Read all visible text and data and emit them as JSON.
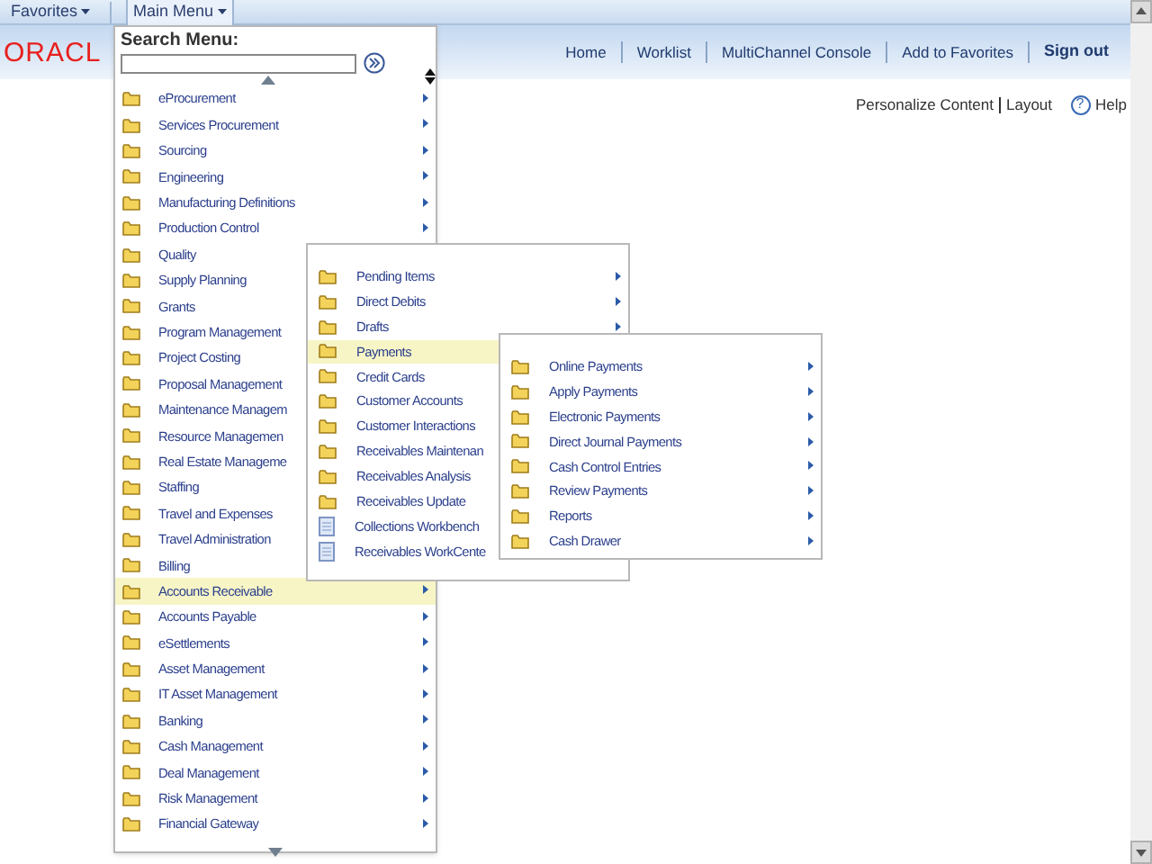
{
  "top_menu": [
    {
      "label": "Favorites",
      "selected": false
    },
    {
      "label": "Main Menu",
      "selected": true
    }
  ],
  "logo": "ORACL",
  "nav_links": [
    {
      "label": "Home",
      "bold": false
    },
    {
      "label": "Worklist",
      "bold": false
    },
    {
      "label": "MultiChannel Console",
      "bold": false
    },
    {
      "label": "Add to Favorites",
      "bold": false
    },
    {
      "label": "Sign out",
      "bold": true
    }
  ],
  "page_links": {
    "personalize": "Personalize Content",
    "layout": "Layout",
    "help": "Help",
    "help_icon": "?"
  },
  "main_menu": {
    "search_label": "Search Menu:",
    "items": [
      {
        "label": "eProcurement",
        "kind": "folder",
        "arrow": true,
        "selected": false
      },
      {
        "label": "Services Procurement",
        "kind": "folder",
        "arrow": true,
        "selected": false
      },
      {
        "label": "Sourcing",
        "kind": "folder",
        "arrow": true,
        "selected": false
      },
      {
        "label": "Engineering",
        "kind": "folder",
        "arrow": true,
        "selected": false
      },
      {
        "label": "Manufacturing Definitions",
        "kind": "folder",
        "arrow": true,
        "selected": false
      },
      {
        "label": "Production Control",
        "kind": "folder",
        "arrow": true,
        "selected": false
      },
      {
        "label": "Quality",
        "kind": "folder",
        "arrow": false,
        "selected": false
      },
      {
        "label": "Supply Planning",
        "kind": "folder",
        "arrow": false,
        "selected": false
      },
      {
        "label": "Grants",
        "kind": "folder",
        "arrow": false,
        "selected": false
      },
      {
        "label": "Program Management",
        "kind": "folder",
        "arrow": false,
        "selected": false
      },
      {
        "label": "Project Costing",
        "kind": "folder",
        "arrow": false,
        "selected": false
      },
      {
        "label": "Proposal Management",
        "kind": "folder",
        "arrow": false,
        "selected": false
      },
      {
        "label": "Maintenance Managem",
        "kind": "folder",
        "arrow": false,
        "selected": false
      },
      {
        "label": "Resource Managemen",
        "kind": "folder",
        "arrow": false,
        "selected": false
      },
      {
        "label": "Real Estate Manageme",
        "kind": "folder",
        "arrow": false,
        "selected": false
      },
      {
        "label": "Staffing",
        "kind": "folder",
        "arrow": false,
        "selected": false
      },
      {
        "label": "Travel and Expenses",
        "kind": "folder",
        "arrow": false,
        "selected": false
      },
      {
        "label": "Travel Administration",
        "kind": "folder",
        "arrow": false,
        "selected": false
      },
      {
        "label": "Billing",
        "kind": "folder",
        "arrow": false,
        "selected": false
      },
      {
        "label": "Accounts Receivable",
        "kind": "folder",
        "arrow": true,
        "selected": true
      },
      {
        "label": "Accounts Payable",
        "kind": "folder",
        "arrow": true,
        "selected": false
      },
      {
        "label": "eSettlements",
        "kind": "folder",
        "arrow": true,
        "selected": false
      },
      {
        "label": "Asset Management",
        "kind": "folder",
        "arrow": true,
        "selected": false
      },
      {
        "label": "IT Asset Management",
        "kind": "folder",
        "arrow": true,
        "selected": false
      },
      {
        "label": "Banking",
        "kind": "folder",
        "arrow": true,
        "selected": false
      },
      {
        "label": "Cash Management",
        "kind": "folder",
        "arrow": true,
        "selected": false
      },
      {
        "label": "Deal Management",
        "kind": "folder",
        "arrow": true,
        "selected": false
      },
      {
        "label": "Risk Management",
        "kind": "folder",
        "arrow": true,
        "selected": false
      },
      {
        "label": "Financial Gateway",
        "kind": "folder",
        "arrow": true,
        "selected": false
      }
    ]
  },
  "submenu": {
    "items": [
      {
        "label": "Pending Items",
        "kind": "folder",
        "arrow": true,
        "selected": false
      },
      {
        "label": "Direct Debits",
        "kind": "folder",
        "arrow": true,
        "selected": false
      },
      {
        "label": "Drafts",
        "kind": "folder",
        "arrow": true,
        "selected": false
      },
      {
        "label": "Payments",
        "kind": "folder",
        "arrow": false,
        "selected": true
      },
      {
        "label": "Credit Cards",
        "kind": "folder",
        "arrow": false,
        "selected": false
      },
      {
        "label": "Customer Accounts",
        "kind": "folder",
        "arrow": false,
        "selected": false
      },
      {
        "label": "Customer Interactions",
        "kind": "folder",
        "arrow": false,
        "selected": false
      },
      {
        "label": "Receivables Maintenan",
        "kind": "folder",
        "arrow": false,
        "selected": false
      },
      {
        "label": "Receivables Analysis",
        "kind": "folder",
        "arrow": false,
        "selected": false
      },
      {
        "label": "Receivables Update",
        "kind": "folder",
        "arrow": false,
        "selected": false
      },
      {
        "label": "Collections Workbench",
        "kind": "page",
        "arrow": false,
        "selected": false
      },
      {
        "label": "Receivables WorkCente",
        "kind": "page",
        "arrow": false,
        "selected": false
      }
    ]
  },
  "payments_menu": {
    "items": [
      {
        "label": "Online Payments",
        "kind": "folder",
        "arrow": true,
        "selected": false
      },
      {
        "label": "Apply Payments",
        "kind": "folder",
        "arrow": true,
        "selected": false
      },
      {
        "label": "Electronic Payments",
        "kind": "folder",
        "arrow": true,
        "selected": false
      },
      {
        "label": "Direct Journal Payments",
        "kind": "folder",
        "arrow": true,
        "selected": false
      },
      {
        "label": "Cash Control Entries",
        "kind": "folder",
        "arrow": true,
        "selected": false
      },
      {
        "label": "Review Payments",
        "kind": "folder",
        "arrow": true,
        "selected": false
      },
      {
        "label": "Reports",
        "kind": "folder",
        "arrow": true,
        "selected": false
      },
      {
        "label": "Cash Drawer",
        "kind": "folder",
        "arrow": true,
        "selected": false
      }
    ]
  }
}
